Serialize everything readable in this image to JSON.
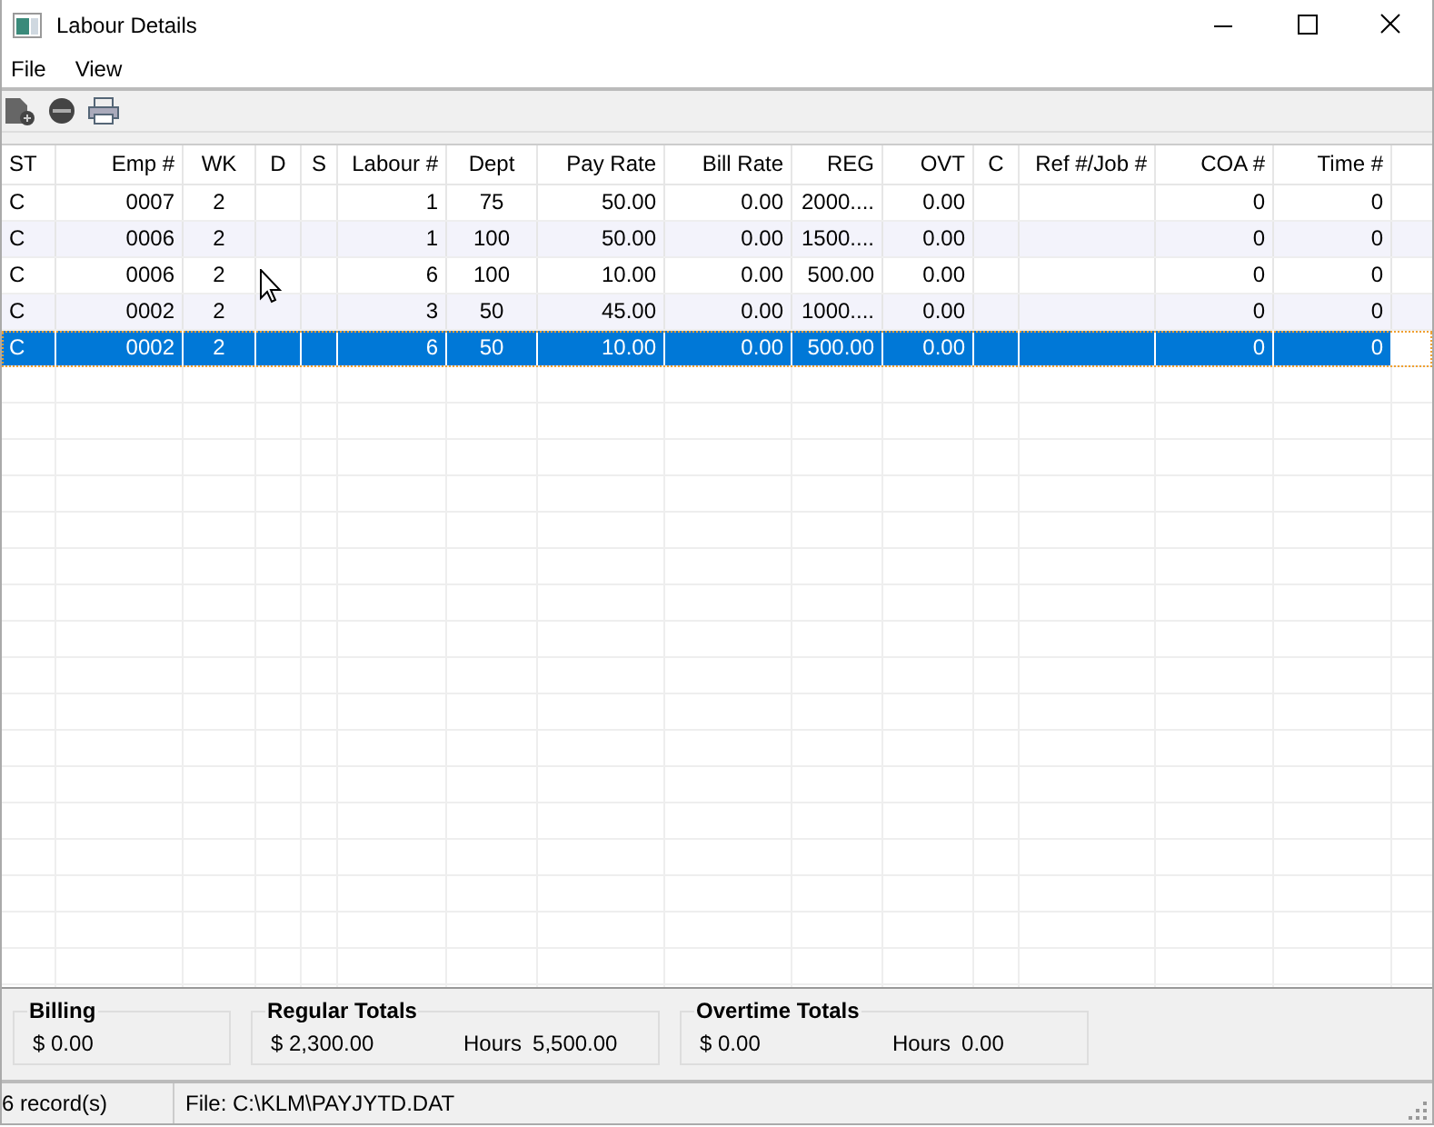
{
  "window": {
    "title": "Labour Details"
  },
  "menu": [
    "File",
    "View"
  ],
  "table": {
    "columns": [
      "ST",
      "Emp #",
      "WK",
      "D",
      "S",
      "Labour #",
      "Dept",
      "Pay Rate",
      "Bill Rate",
      "REG",
      "OVT",
      "C",
      "Ref #/Job #",
      "COA #",
      "Time #"
    ],
    "rows": [
      {
        "selected": false,
        "cells": [
          "C",
          "0007",
          "2",
          "",
          "",
          "1",
          "75",
          "50.00",
          "0.00",
          "2000....",
          "0.00",
          "",
          "",
          "0",
          "0"
        ]
      },
      {
        "selected": false,
        "cells": [
          "C",
          "0006",
          "2",
          "",
          "",
          "1",
          "100",
          "50.00",
          "0.00",
          "1500....",
          "0.00",
          "",
          "",
          "0",
          "0"
        ]
      },
      {
        "selected": false,
        "cells": [
          "C",
          "0006",
          "2",
          "",
          "",
          "6",
          "100",
          "10.00",
          "0.00",
          "500.00",
          "0.00",
          "",
          "",
          "0",
          "0"
        ]
      },
      {
        "selected": false,
        "cells": [
          "C",
          "0002",
          "2",
          "",
          "",
          "3",
          "50",
          "45.00",
          "0.00",
          "1000....",
          "0.00",
          "",
          "",
          "0",
          "0"
        ]
      },
      {
        "selected": true,
        "cells": [
          "C",
          "0002",
          "2",
          "",
          "",
          "6",
          "50",
          "10.00",
          "0.00",
          "500.00",
          "0.00",
          "",
          "",
          "0",
          "0"
        ]
      }
    ]
  },
  "totals": [
    {
      "title": "Billing",
      "amount": "$  0.00"
    },
    {
      "title": "Regular Totals",
      "amount": "$  2,300.00",
      "hours_label": "Hours",
      "hours": "5,500.00"
    },
    {
      "title": "Overtime Totals",
      "amount": "$  0.00",
      "hours_label": "Hours",
      "hours": "0.00"
    }
  ],
  "status_bar": {
    "records": "6 record(s)",
    "file": "File: C:\\KLM\\PAYJYTD.DAT"
  }
}
